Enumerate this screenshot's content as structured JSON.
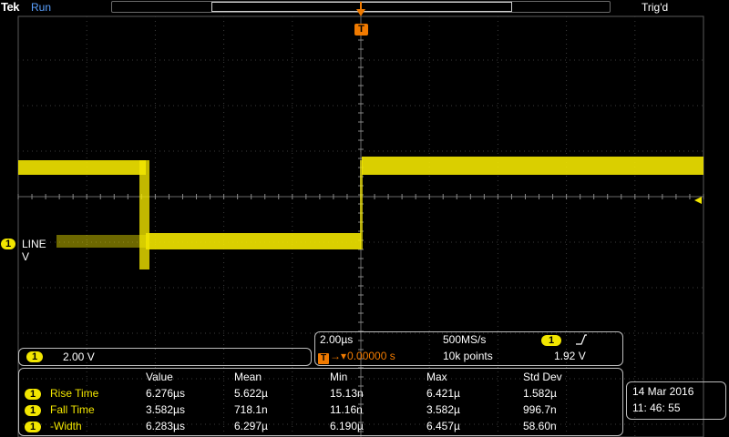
{
  "header": {
    "brand": "Tek",
    "run_state": "Run",
    "trigger_state": "Trig'd"
  },
  "channel": {
    "badge": "1",
    "label": "LINE V",
    "scale": "2.00 V",
    "color": "#f2e600"
  },
  "trigger": {
    "marker": "T",
    "level": "1.92 V",
    "slope": "rising-edge-icon",
    "color": "#f07a00"
  },
  "horizontal": {
    "time_per_div": "2.00µs",
    "sample_rate": "500MS/s",
    "delay_value": "0.00000 s",
    "record_length": "10k points"
  },
  "measurements": {
    "headers": [
      "Value",
      "Mean",
      "Min",
      "Max",
      "Std Dev"
    ],
    "rows": [
      {
        "source": "1",
        "name": "Rise Time",
        "value": "6.276µs",
        "mean": "5.622µ",
        "min": "15.13n",
        "max": "6.421µ",
        "std_dev": "1.582µ"
      },
      {
        "source": "1",
        "name": "Fall Time",
        "value": "3.582µs",
        "mean": "718.1n",
        "min": "11.16n",
        "max": "3.582µ",
        "std_dev": "996.7n"
      },
      {
        "source": "1",
        "name": "-Width",
        "value": "6.283µs",
        "mean": "6.297µ",
        "min": "6.190µ",
        "max": "6.457µ",
        "std_dev": "58.60n"
      }
    ]
  },
  "clock": {
    "date": "14 Mar   2016",
    "time": "11: 46: 55"
  }
}
